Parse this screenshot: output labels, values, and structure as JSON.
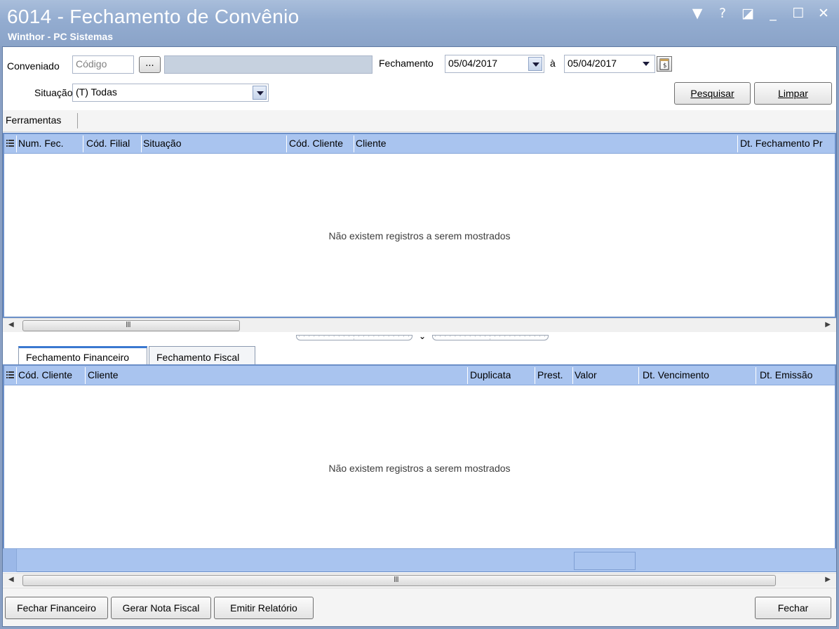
{
  "window": {
    "title": "6014 - Fechamento de Convênio",
    "subtitle": "Winthor - PC Sistemas",
    "controls": [
      "▼",
      "?",
      "◪",
      "_",
      "☐",
      "✕"
    ]
  },
  "filters": {
    "conveniado_label": "Conveniado",
    "codigo_placeholder": "Código",
    "lookup_button": "...",
    "conveniado_name": "",
    "fechamento_label": "Fechamento",
    "date_from": "05/04/2017",
    "date_sep": "à",
    "date_to": "05/04/2017",
    "situacao_label": "Situação",
    "situacao_value": "(T) Todas",
    "pesquisar": "Pesquisar",
    "limpar": "Limpar"
  },
  "toolbar": {
    "ferramentas": "Ferramentas"
  },
  "grid_top": {
    "columns": [
      "Num. Fec.",
      "Cód. Filial",
      "Situação",
      "Cód. Cliente",
      "Cliente",
      "Dt. Fechamento Pr"
    ],
    "empty_message": "Não existem registros a serem mostrados",
    "scroll_grip": "III"
  },
  "tabs": [
    "Fechamento Financeiro",
    "Fechamento Fiscal"
  ],
  "grid_bottom": {
    "columns": [
      "Cód. Cliente",
      "Cliente",
      "Duplicata",
      "Prest.",
      "Valor",
      "Dt. Vencimento",
      "Dt. Emissão"
    ],
    "empty_message": "Não existem registros a serem mostrados",
    "scroll_grip": "III"
  },
  "footer": {
    "fechar_financeiro": "Fechar Financeiro",
    "gerar_nota_fiscal": "Gerar Nota Fiscal",
    "emitir_relatorio": "Emitir Relatório",
    "fechar": "Fechar"
  },
  "colors": {
    "title_bar": "#93acd0",
    "grid_header": "#a9c4ef",
    "grid_border": "#6b8fc8",
    "active_tab_accent": "#3a78d0"
  }
}
